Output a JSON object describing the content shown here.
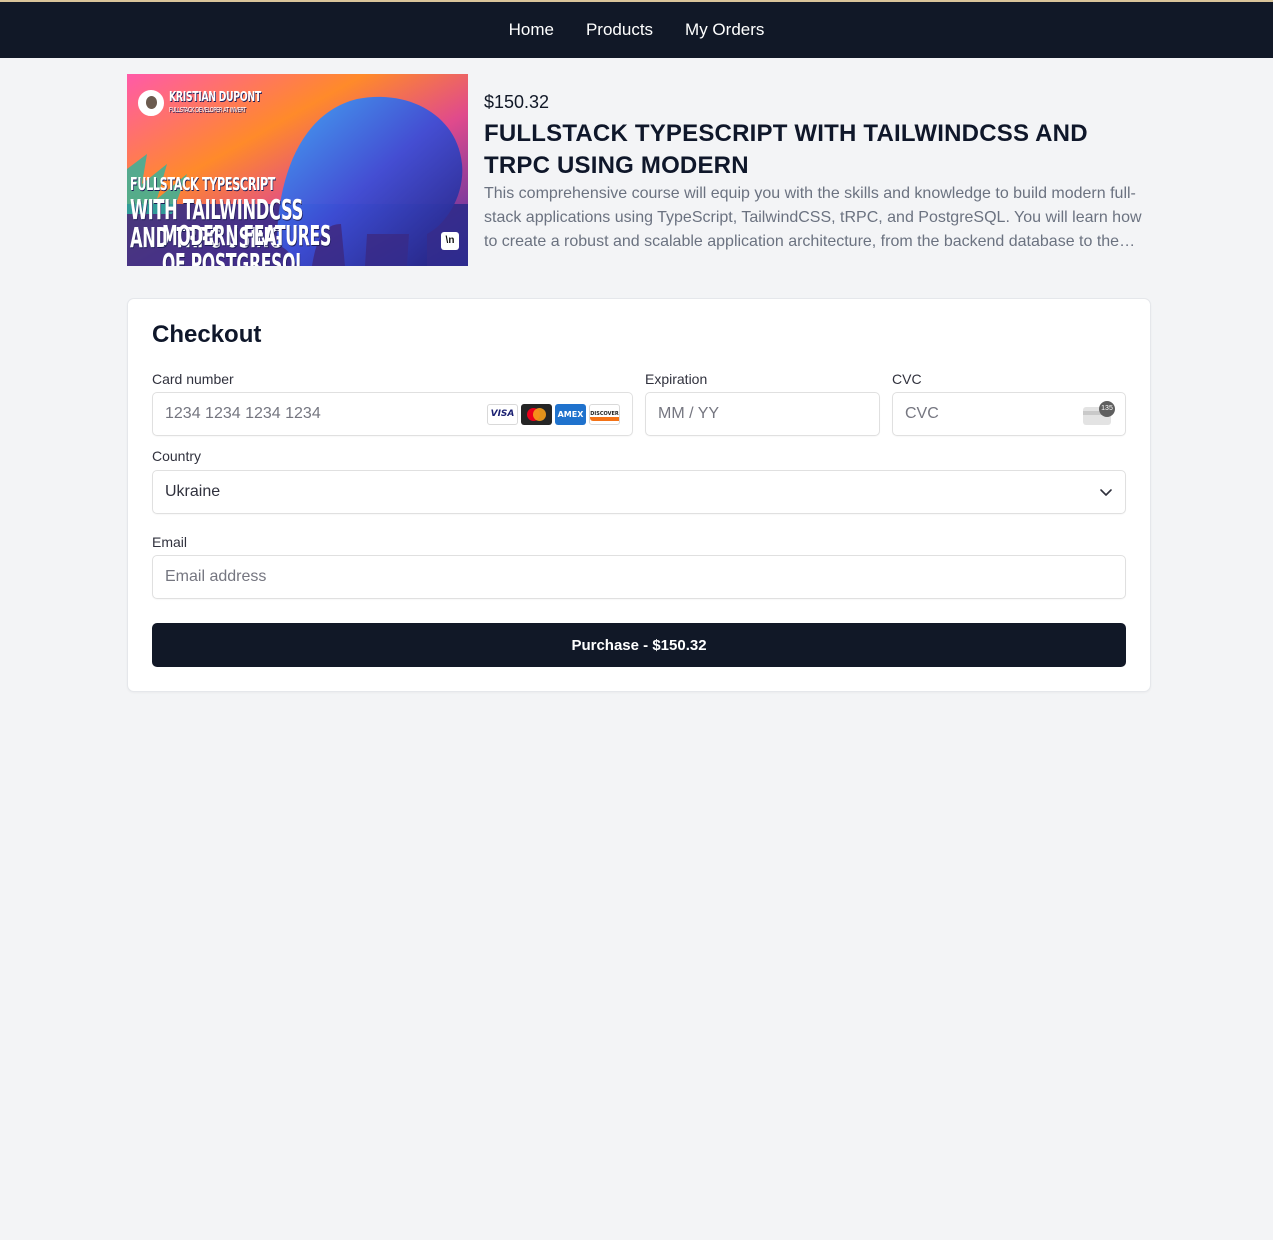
{
  "nav": {
    "items": [
      {
        "label": "Home"
      },
      {
        "label": "Products"
      },
      {
        "label": "My Orders"
      }
    ]
  },
  "product": {
    "price": "$150.32",
    "title": "FULLSTACK TYPESCRIPT WITH TAILWINDCSS AND TRPC USING MODERN",
    "description": "This comprehensive course will equip you with the skills and knowledge to build modern full-stack applications using TypeScript, TailwindCSS, tRPC, and PostgreSQL. You will learn how to create a robust and scalable application architecture, from the backend database to the frontend user interface.",
    "thumbnail": {
      "author": "KRISTIAN DUPONT",
      "author_subtitle": "FULLSTACK DEVELOPER AT INVERT",
      "line1": "FULLSTACK TYPESCRIPT",
      "line2": "WITH TAILWINDCSS AND TRPC USING",
      "line3": "MODERN FEATURES OF POSTGRESQL",
      "badge": "\\n"
    }
  },
  "checkout": {
    "heading": "Checkout",
    "card_number_label": "Card number",
    "card_number_placeholder": "1234 1234 1234 1234",
    "card_brands": [
      "VISA",
      "mastercard",
      "AMEX",
      "DISCOVER"
    ],
    "expiration_label": "Expiration",
    "expiration_placeholder": "MM / YY",
    "cvc_label": "CVC",
    "cvc_placeholder": "CVC",
    "cvc_icon_number": "135",
    "country_label": "Country",
    "country_value": "Ukraine",
    "email_label": "Email",
    "email_placeholder": "Email address",
    "purchase_label": "Purchase - $150.32"
  },
  "colors": {
    "nav_bg": "#111827",
    "page_bg": "#f3f4f6",
    "button_bg": "#111827"
  }
}
